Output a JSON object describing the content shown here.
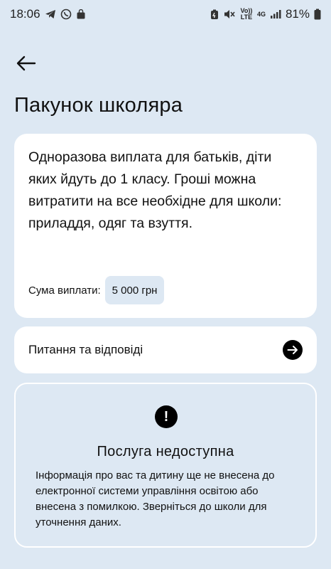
{
  "status_bar": {
    "time": "18:06",
    "battery": "81%",
    "volte_label": "Vo)) LTE",
    "network_label": "4G"
  },
  "header": {
    "title": "Пакунок школяра"
  },
  "description_card": {
    "text": "Одноразова виплата для батьків, діти яких йдуть до 1 класу. Гроші можна витратити на все необхідне для школи: приладдя, одяг та взуття.",
    "amount_label": "Сума виплати:",
    "amount_value": "5 000 грн"
  },
  "faq_card": {
    "label": "Питання та відповіді"
  },
  "unavailable_card": {
    "title": "Послуга недоступна",
    "text": "Інформація про вас та дитину ще не внесена до електронної системи управління освітою або внесена з помилкою. Зверніться до школи для уточнення даних."
  },
  "colors": {
    "background": "#dde8f3",
    "card": "#ffffff",
    "accent": "#000000"
  }
}
